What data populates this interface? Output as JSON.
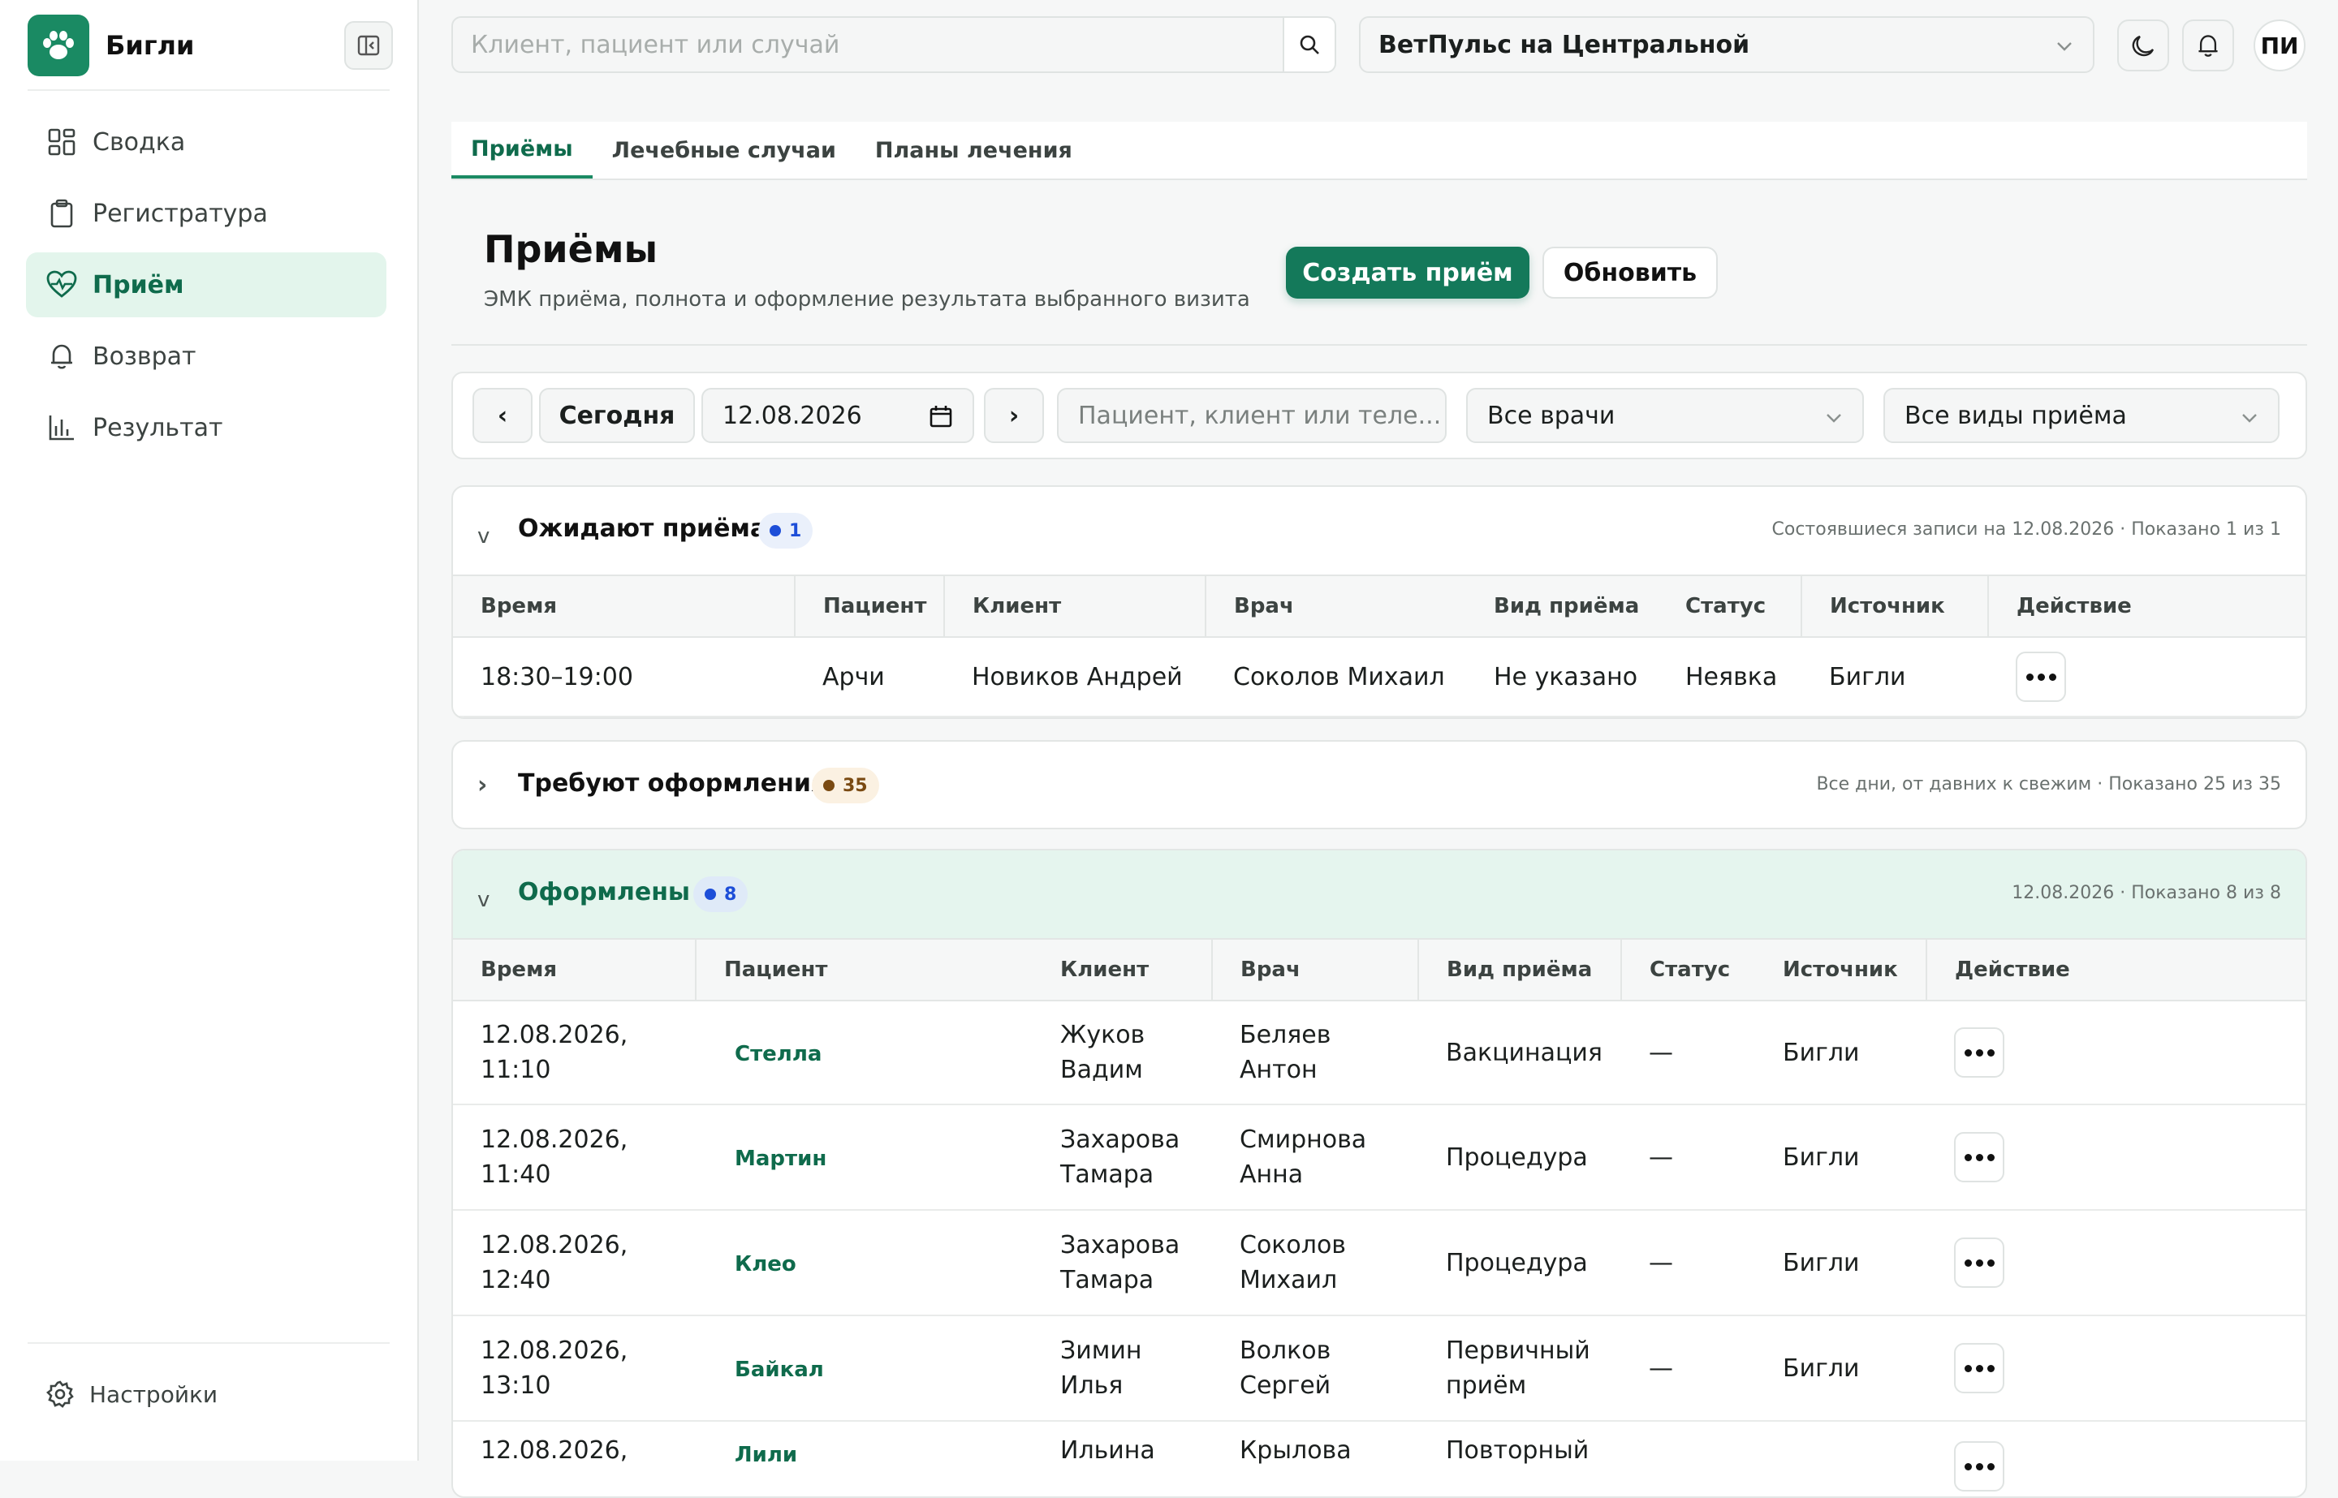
{
  "app": {
    "name": "Бигли"
  },
  "sidebar": {
    "items": [
      {
        "label": "Сводка",
        "icon": "dashboard-icon"
      },
      {
        "label": "Регистратура",
        "icon": "clipboard-icon"
      },
      {
        "label": "Приём",
        "icon": "heart-pulse-icon",
        "active": true
      },
      {
        "label": "Возврат",
        "icon": "bell-icon"
      },
      {
        "label": "Результат",
        "icon": "bar-chart-icon"
      }
    ],
    "settings_label": "Настройки"
  },
  "topbar": {
    "search_placeholder": "Клиент, пациент или случай",
    "clinic": "ВетПульс на Центральной",
    "avatar": "ПИ"
  },
  "tabs": [
    {
      "label": "Приёмы",
      "active": true
    },
    {
      "label": "Лечебные случаи"
    },
    {
      "label": "Планы лечения"
    }
  ],
  "page": {
    "title": "Приёмы",
    "subtitle": "ЭМК приёма, полнота и оформление результата выбранного визита",
    "create_button": "Создать приём",
    "refresh_button": "Обновить"
  },
  "filters": {
    "prev": "‹",
    "today": "Сегодня",
    "date": "12.08.2026",
    "next": "›",
    "search_placeholder": "Пациент, клиент или теле...",
    "doctor": "Все врачи",
    "visit_type": "Все виды приёма"
  },
  "waiting": {
    "title": "Ожидают приёма",
    "count": "1",
    "meta": "Состоявшиеся записи на 12.08.2026 · Показано 1 из 1",
    "toggle": "v",
    "columns": [
      "Время",
      "Пациент",
      "Клиент",
      "Врач",
      "Вид приёма",
      "Статус",
      "Источник",
      "Действие"
    ],
    "rows": [
      {
        "time": "18:30–19:00",
        "patient": "Арчи",
        "client": "Новиков Андрей",
        "doctor": "Соколов Михаил",
        "type": "Не указано",
        "status": "Неявка",
        "source": "Бигли"
      }
    ]
  },
  "pending": {
    "title": "Требуют оформления",
    "count": "35",
    "meta": "Все дни, от давних к свежим · Показано 25 из 35",
    "toggle": "›"
  },
  "done": {
    "title": "Оформлены",
    "count": "8",
    "meta": "12.08.2026 · Показано 8 из 8",
    "toggle": "v",
    "columns": [
      "Время",
      "Пациент",
      "Клиент",
      "Врач",
      "Вид приёма",
      "Статус",
      "Источник",
      "Действие"
    ],
    "rows": [
      {
        "date": "12.08.2026,",
        "time": "11:10",
        "patient": "Стелла",
        "client1": "Жуков",
        "client2": "Вадим",
        "doctor1": "Беляев",
        "doctor2": "Антон",
        "type1": "Вакцинация",
        "type2": "",
        "status": "—",
        "source": "Бигли"
      },
      {
        "date": "12.08.2026,",
        "time": "11:40",
        "patient": "Мартин",
        "client1": "Захарова",
        "client2": "Тамара",
        "doctor1": "Смирнова",
        "doctor2": "Анна",
        "type1": "Процедура",
        "type2": "",
        "status": "—",
        "source": "Бигли"
      },
      {
        "date": "12.08.2026,",
        "time": "12:40",
        "patient": "Клео",
        "client1": "Захарова",
        "client2": "Тамара",
        "doctor1": "Соколов",
        "doctor2": "Михаил",
        "type1": "Процедура",
        "type2": "",
        "status": "—",
        "source": "Бигли"
      },
      {
        "date": "12.08.2026,",
        "time": "13:10",
        "patient": "Байкал",
        "client1": "Зимин",
        "client2": "Илья",
        "doctor1": "Волков",
        "doctor2": "Сергей",
        "type1": "Первичный",
        "type2": "приём",
        "status": "—",
        "source": "Бигли"
      },
      {
        "date": "12.08.2026,",
        "time": "",
        "patient": "Лили",
        "client1": "Ильина",
        "client2": "",
        "doctor1": "Крылова",
        "doctor2": "",
        "type1": "Повторный",
        "type2": "",
        "status": "",
        "source": ""
      }
    ]
  },
  "colors": {
    "accent": "#1a8a63",
    "accent_dark": "#14795a",
    "accent_bg": "#e3f5ec",
    "blue_dot": "#1d4ed8",
    "amber_dot": "#7a4a12"
  }
}
